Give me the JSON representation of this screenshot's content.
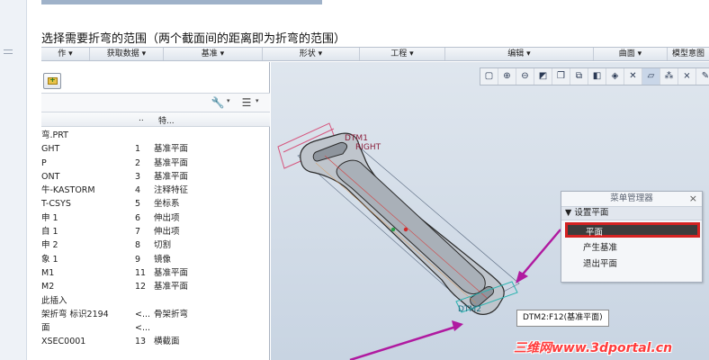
{
  "caption": "选择需要折弯的范围（两个截面间的距离即为折弯的范围）",
  "menubar": [
    {
      "label": "作 ▾"
    },
    {
      "label": "获取数据 ▾"
    },
    {
      "label": "基准 ▾"
    },
    {
      "label": "形状 ▾"
    },
    {
      "label": "工程 ▾"
    },
    {
      "label": "编辑 ▾"
    },
    {
      "label": "曲面 ▾"
    },
    {
      "label": "模型意图"
    }
  ],
  "tree": {
    "header_col2": "..",
    "header_col3": "特...",
    "rows": [
      {
        "name": "弯.PRT",
        "num": "",
        "type": ""
      },
      {
        "name": "GHT",
        "num": "1",
        "type": "基准平面"
      },
      {
        "name": "P",
        "num": "2",
        "type": "基准平面"
      },
      {
        "name": "ONT",
        "num": "3",
        "type": "基准平面"
      },
      {
        "name": "牛-KASTORM",
        "num": "4",
        "type": "注释特征"
      },
      {
        "name": "T-CSYS",
        "num": "5",
        "type": "坐标系"
      },
      {
        "name": "申 1",
        "num": "6",
        "type": "伸出项"
      },
      {
        "name": "自 1",
        "num": "7",
        "type": "伸出项"
      },
      {
        "name": "申 2",
        "num": "8",
        "type": "切割"
      },
      {
        "name": "象 1",
        "num": "9",
        "type": "镜像"
      },
      {
        "name": "M1",
        "num": "11",
        "type": "基准平面"
      },
      {
        "name": "M2",
        "num": "12",
        "type": "基准平面"
      },
      {
        "name": "此插入",
        "num": "",
        "type": ""
      },
      {
        "name": "架折弯 标识2194",
        "num": "<...",
        "type": "骨架折弯"
      },
      {
        "name": "面",
        "num": "<...",
        "type": ""
      },
      {
        "name": "XSEC0001",
        "num": "13",
        "type": "横截面"
      }
    ]
  },
  "viewport": {
    "dtm1_label": "DTM1",
    "right_label": "RIGHT",
    "dtm2_label": "DTM2",
    "tooltip": "DTM2:F12(基准平面)"
  },
  "menu_manager": {
    "title": "菜单管理器",
    "section": "▼ 设置平面",
    "items": [
      {
        "label": "平面",
        "selected": true
      },
      {
        "label": "产生基准",
        "selected": false
      },
      {
        "label": "退出平面",
        "selected": false
      }
    ]
  },
  "watermark": "三维网www.3dportal.cn",
  "colors": {
    "highlight_border": "#d42222",
    "arrow": "#b01aa0",
    "model_outline": "#2a2a2a"
  }
}
